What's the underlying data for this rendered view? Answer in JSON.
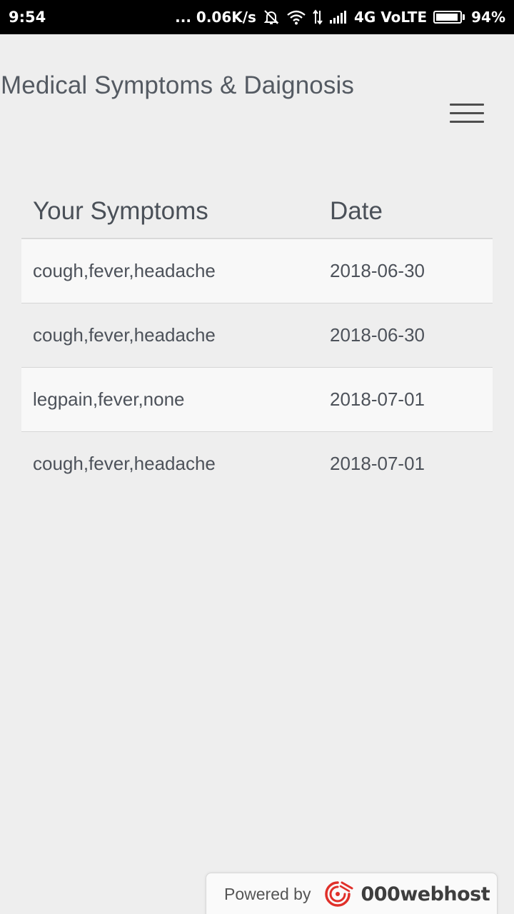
{
  "status_bar": {
    "time": "9:54",
    "network_speed": "... 0.06K/s",
    "network_type": "4G VoLTE",
    "battery_percent": "94%",
    "battery_level": 0.94
  },
  "header": {
    "title": "Medical Symptoms & Daignosis",
    "menu_icon": "hamburger-menu-icon"
  },
  "table": {
    "columns": [
      "Your Symptoms",
      "Date"
    ],
    "rows": [
      {
        "symptoms": "cough,fever,headache",
        "date": "2018-06-30"
      },
      {
        "symptoms": "cough,fever,headache",
        "date": "2018-06-30"
      },
      {
        "symptoms": "legpain,fever,none",
        "date": "2018-07-01"
      },
      {
        "symptoms": "cough,fever,headache",
        "date": "2018-07-01"
      }
    ]
  },
  "footer": {
    "powered_by": "Powered by",
    "brand": "000webhost",
    "logo_icon": "000webhost-logo-icon"
  },
  "colors": {
    "background": "#eeeeee",
    "status_bar": "#000000",
    "row_alt": "#f8f8f8",
    "logo_red": "#e0302a"
  }
}
